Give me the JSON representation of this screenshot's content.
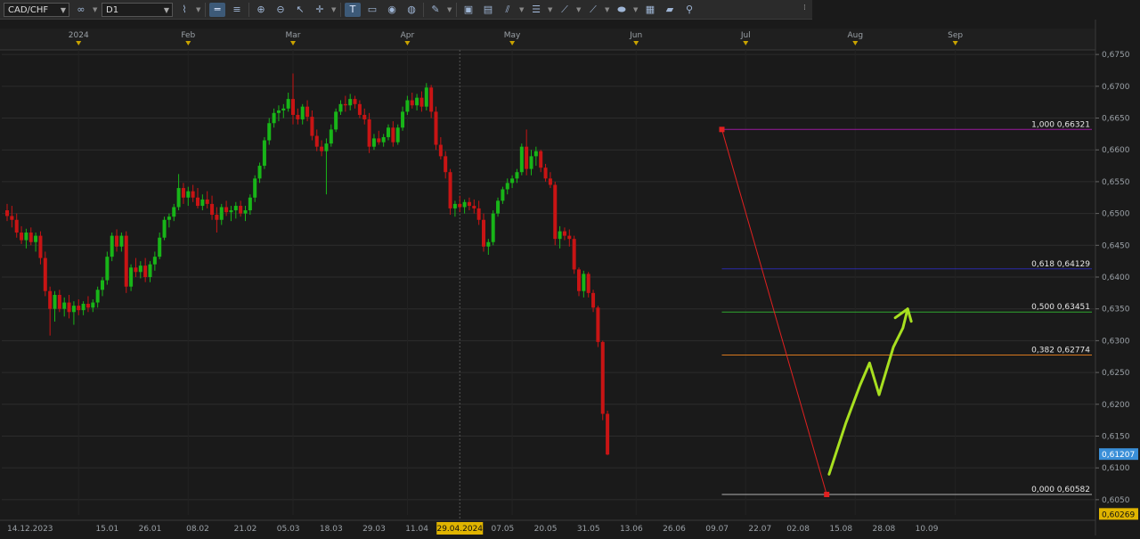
{
  "toolbar": {
    "symbol": "CAD/CHF",
    "timeframe": "D1",
    "icons": [
      "chart-type-icon",
      "line-style-icon",
      "zoom-in-icon",
      "zoom-out-icon",
      "cursor-icon",
      "crosshair-icon",
      "text-icon",
      "note-icon",
      "eye-icon",
      "globe-icon",
      "pencil-icon",
      "image-icon",
      "screenshot-icon",
      "fib-icon",
      "channel-icon",
      "trendline-icon",
      "arrow-icon",
      "shape-icon",
      "grid-icon",
      "eraser-icon",
      "indicator-icon"
    ]
  },
  "colors": {
    "bull": "#18b518",
    "bear": "#c81414",
    "grid": "#2c2c2c",
    "bg": "#1a1a1a",
    "axis_text": "#9aa0a6",
    "price_badge": "#3a8fd8",
    "low_badge": "#e0b400"
  },
  "chart_data": {
    "type": "candlestick",
    "symbol": "CAD/CHF",
    "timeframe": "D1",
    "ylim": [
      0.6026,
      0.676
    ],
    "y_ticks": [
      "0,6750",
      "0,6700",
      "0,6650",
      "0,6600",
      "0,6550",
      "0,6500",
      "0,6450",
      "0,6400",
      "0,6350",
      "0,6300",
      "0,6250",
      "0,6200",
      "0,6150",
      "0,6100",
      "0,6050"
    ],
    "y_tick_values": [
      0.675,
      0.67,
      0.665,
      0.66,
      0.655,
      0.65,
      0.645,
      0.64,
      0.635,
      0.63,
      0.625,
      0.62,
      0.615,
      0.61,
      0.605
    ],
    "month_labels": [
      {
        "label": "2024",
        "index": 15
      },
      {
        "label": "Feb",
        "index": 38
      },
      {
        "label": "Mar",
        "index": 60
      },
      {
        "label": "Apr",
        "index": 84
      },
      {
        "label": "May",
        "index": 106
      },
      {
        "label": "Jun",
        "index": 132
      },
      {
        "label": "Jul",
        "index": 155
      },
      {
        "label": "Aug",
        "index": 178
      },
      {
        "label": "Sep",
        "index": 199
      }
    ],
    "date_labels": [
      {
        "label": "14.12.2023",
        "index": 0
      },
      {
        "label": "15.01",
        "index": 21
      },
      {
        "label": "26.01",
        "index": 30
      },
      {
        "label": "08.02",
        "index": 40
      },
      {
        "label": "21.02",
        "index": 50
      },
      {
        "label": "05.03",
        "index": 59
      },
      {
        "label": "18.03",
        "index": 68
      },
      {
        "label": "29.03",
        "index": 77
      },
      {
        "label": "11.04",
        "index": 86
      },
      {
        "label": "07.05",
        "index": 104
      },
      {
        "label": "20.05",
        "index": 113
      },
      {
        "label": "31.05",
        "index": 122
      },
      {
        "label": "13.06",
        "index": 131
      },
      {
        "label": "26.06",
        "index": 140
      },
      {
        "label": "09.07",
        "index": 149
      },
      {
        "label": "22.07",
        "index": 158
      },
      {
        "label": "02.08",
        "index": 166
      },
      {
        "label": "15.08",
        "index": 175
      },
      {
        "label": "28.08",
        "index": 184
      },
      {
        "label": "10.09",
        "index": 193
      }
    ],
    "cursor_date": "29.04.2024",
    "cursor_index": 95,
    "current_price": "0,61207",
    "low_price": "0,60269",
    "candles": [
      [
        0.6505,
        0.6515,
        0.6488,
        0.6496
      ],
      [
        0.6496,
        0.6512,
        0.6478,
        0.649
      ],
      [
        0.649,
        0.65,
        0.6462,
        0.647
      ],
      [
        0.647,
        0.648,
        0.6452,
        0.6458
      ],
      [
        0.6458,
        0.6476,
        0.6445,
        0.647
      ],
      [
        0.647,
        0.6478,
        0.645,
        0.6455
      ],
      [
        0.6455,
        0.647,
        0.644,
        0.6465
      ],
      [
        0.6465,
        0.6472,
        0.642,
        0.643
      ],
      [
        0.643,
        0.644,
        0.637,
        0.6378
      ],
      [
        0.6378,
        0.6385,
        0.6308,
        0.635
      ],
      [
        0.635,
        0.6378,
        0.633,
        0.6372
      ],
      [
        0.6372,
        0.638,
        0.6345,
        0.635
      ],
      [
        0.635,
        0.6368,
        0.6338,
        0.636
      ],
      [
        0.636,
        0.6372,
        0.6335,
        0.6345
      ],
      [
        0.6345,
        0.6362,
        0.6325,
        0.6355
      ],
      [
        0.6355,
        0.6365,
        0.634,
        0.6348
      ],
      [
        0.6348,
        0.6362,
        0.634,
        0.6358
      ],
      [
        0.6358,
        0.637,
        0.6345,
        0.6352
      ],
      [
        0.6352,
        0.6365,
        0.6345,
        0.636
      ],
      [
        0.636,
        0.6385,
        0.6352,
        0.638
      ],
      [
        0.638,
        0.64,
        0.637,
        0.6395
      ],
      [
        0.6395,
        0.644,
        0.6388,
        0.6432
      ],
      [
        0.6432,
        0.647,
        0.6425,
        0.6465
      ],
      [
        0.6465,
        0.6475,
        0.644,
        0.6448
      ],
      [
        0.6448,
        0.647,
        0.644,
        0.6465
      ],
      [
        0.6465,
        0.6472,
        0.6375,
        0.6385
      ],
      [
        0.6385,
        0.642,
        0.6378,
        0.6415
      ],
      [
        0.6415,
        0.643,
        0.64,
        0.6408
      ],
      [
        0.6408,
        0.6425,
        0.6398,
        0.6418
      ],
      [
        0.6418,
        0.643,
        0.6392,
        0.64
      ],
      [
        0.64,
        0.6425,
        0.6392,
        0.642
      ],
      [
        0.642,
        0.644,
        0.641,
        0.6432
      ],
      [
        0.6432,
        0.647,
        0.6428,
        0.6462
      ],
      [
        0.6462,
        0.6495,
        0.6458,
        0.649
      ],
      [
        0.649,
        0.65,
        0.6478,
        0.6495
      ],
      [
        0.6495,
        0.6515,
        0.6488,
        0.651
      ],
      [
        0.651,
        0.6562,
        0.6505,
        0.654
      ],
      [
        0.654,
        0.6548,
        0.6515,
        0.6525
      ],
      [
        0.6525,
        0.6542,
        0.6512,
        0.6535
      ],
      [
        0.6535,
        0.6545,
        0.6518,
        0.6525
      ],
      [
        0.6525,
        0.654,
        0.6508,
        0.6512
      ],
      [
        0.6512,
        0.653,
        0.6505,
        0.6522
      ],
      [
        0.6522,
        0.6535,
        0.6508,
        0.6515
      ],
      [
        0.6515,
        0.6528,
        0.649,
        0.6498
      ],
      [
        0.6498,
        0.651,
        0.647,
        0.649
      ],
      [
        0.649,
        0.6515,
        0.6482,
        0.651
      ],
      [
        0.651,
        0.652,
        0.6496,
        0.6502
      ],
      [
        0.6502,
        0.6512,
        0.6488,
        0.6505
      ],
      [
        0.6505,
        0.6518,
        0.6492,
        0.6512
      ],
      [
        0.6512,
        0.652,
        0.6495,
        0.65
      ],
      [
        0.65,
        0.6512,
        0.6488,
        0.6505
      ],
      [
        0.6505,
        0.653,
        0.6498,
        0.6525
      ],
      [
        0.6525,
        0.656,
        0.6518,
        0.6555
      ],
      [
        0.6555,
        0.658,
        0.6548,
        0.6575
      ],
      [
        0.6575,
        0.662,
        0.657,
        0.6615
      ],
      [
        0.6615,
        0.665,
        0.6608,
        0.6642
      ],
      [
        0.6642,
        0.6665,
        0.6635,
        0.6658
      ],
      [
        0.6658,
        0.667,
        0.6645,
        0.6662
      ],
      [
        0.6662,
        0.6672,
        0.665,
        0.6665
      ],
      [
        0.6665,
        0.669,
        0.666,
        0.668
      ],
      [
        0.668,
        0.672,
        0.664,
        0.6655
      ],
      [
        0.6655,
        0.6665,
        0.664,
        0.6648
      ],
      [
        0.6648,
        0.6672,
        0.664,
        0.6668
      ],
      [
        0.6668,
        0.6678,
        0.6645,
        0.6652
      ],
      [
        0.6652,
        0.6662,
        0.6615,
        0.6622
      ],
      [
        0.6622,
        0.6632,
        0.6598,
        0.6605
      ],
      [
        0.6605,
        0.6615,
        0.659,
        0.6598
      ],
      [
        0.6598,
        0.6618,
        0.653,
        0.661
      ],
      [
        0.661,
        0.664,
        0.6605,
        0.6632
      ],
      [
        0.6632,
        0.6665,
        0.6628,
        0.666
      ],
      [
        0.666,
        0.6678,
        0.6655,
        0.6672
      ],
      [
        0.6672,
        0.6685,
        0.666,
        0.667
      ],
      [
        0.667,
        0.6688,
        0.6662,
        0.668
      ],
      [
        0.668,
        0.6685,
        0.6665,
        0.6672
      ],
      [
        0.6672,
        0.6678,
        0.665,
        0.6655
      ],
      [
        0.6655,
        0.6665,
        0.664,
        0.6648
      ],
      [
        0.6648,
        0.6658,
        0.6595,
        0.6605
      ],
      [
        0.6605,
        0.6625,
        0.66,
        0.6618
      ],
      [
        0.6618,
        0.663,
        0.6608,
        0.6612
      ],
      [
        0.6612,
        0.6625,
        0.6605,
        0.662
      ],
      [
        0.662,
        0.664,
        0.6615,
        0.6635
      ],
      [
        0.6635,
        0.6645,
        0.6605,
        0.6612
      ],
      [
        0.6612,
        0.664,
        0.6608,
        0.6635
      ],
      [
        0.6635,
        0.6668,
        0.663,
        0.666
      ],
      [
        0.666,
        0.6685,
        0.6655,
        0.6678
      ],
      [
        0.6678,
        0.669,
        0.6665,
        0.667
      ],
      [
        0.667,
        0.6688,
        0.6662,
        0.6682
      ],
      [
        0.6682,
        0.6692,
        0.666,
        0.6668
      ],
      [
        0.6668,
        0.6705,
        0.6662,
        0.6698
      ],
      [
        0.6698,
        0.6702,
        0.665,
        0.666
      ],
      [
        0.666,
        0.6668,
        0.66,
        0.6608
      ],
      [
        0.6608,
        0.662,
        0.6585,
        0.659
      ],
      [
        0.659,
        0.6598,
        0.6555,
        0.6565
      ],
      [
        0.6565,
        0.657,
        0.6498,
        0.6508
      ],
      [
        0.6508,
        0.652,
        0.6495,
        0.6515
      ],
      [
        0.6515,
        0.6528,
        0.6502,
        0.651
      ],
      [
        0.651,
        0.6522,
        0.65,
        0.6518
      ],
      [
        0.6518,
        0.6525,
        0.6505,
        0.6512
      ],
      [
        0.6512,
        0.6522,
        0.65,
        0.6508
      ],
      [
        0.6508,
        0.652,
        0.6482,
        0.649
      ],
      [
        0.649,
        0.65,
        0.644,
        0.6448
      ],
      [
        0.6448,
        0.646,
        0.6435,
        0.6455
      ],
      [
        0.6455,
        0.6505,
        0.645,
        0.65
      ],
      [
        0.65,
        0.6525,
        0.6495,
        0.652
      ],
      [
        0.652,
        0.6542,
        0.6515,
        0.6538
      ],
      [
        0.6538,
        0.6555,
        0.653,
        0.6548
      ],
      [
        0.6548,
        0.656,
        0.654,
        0.6555
      ],
      [
        0.6555,
        0.657,
        0.6548,
        0.6565
      ],
      [
        0.6565,
        0.661,
        0.656,
        0.6605
      ],
      [
        0.6605,
        0.6632,
        0.656,
        0.657
      ],
      [
        0.657,
        0.66,
        0.656,
        0.659
      ],
      [
        0.659,
        0.6605,
        0.6575,
        0.6598
      ],
      [
        0.6598,
        0.66,
        0.6565,
        0.6572
      ],
      [
        0.6572,
        0.6578,
        0.655,
        0.6555
      ],
      [
        0.6555,
        0.6565,
        0.654,
        0.6545
      ],
      [
        0.6545,
        0.655,
        0.645,
        0.646
      ],
      [
        0.646,
        0.648,
        0.6445,
        0.6472
      ],
      [
        0.6472,
        0.6478,
        0.6458,
        0.6465
      ],
      [
        0.6465,
        0.6475,
        0.6448,
        0.646
      ],
      [
        0.646,
        0.6465,
        0.6405,
        0.6412
      ],
      [
        0.6412,
        0.6415,
        0.637,
        0.6378
      ],
      [
        0.6378,
        0.641,
        0.6368,
        0.6405
      ],
      [
        0.6405,
        0.6408,
        0.6368,
        0.6375
      ],
      [
        0.6375,
        0.638,
        0.6345,
        0.6352
      ],
      [
        0.6352,
        0.6355,
        0.629,
        0.6298
      ],
      [
        0.6298,
        0.63,
        0.6175,
        0.6185
      ],
      [
        0.6185,
        0.619,
        0.612,
        0.6121
      ]
    ],
    "fibonacci": {
      "start_index": 150,
      "end_index": 172,
      "levels": [
        {
          "ratio": "1,000",
          "price": 0.66321,
          "label": "1,000 0,66321",
          "color": "#9b1aa0"
        },
        {
          "ratio": "0,618",
          "price": 0.64129,
          "label": "0,618 0,64129",
          "color": "#2a2aa8"
        },
        {
          "ratio": "0,500",
          "price": 0.63451,
          "label": "0,500 0,63451",
          "color": "#2ea82e"
        },
        {
          "ratio": "0,382",
          "price": 0.62774,
          "label": "0,382 0,62774",
          "color": "#d8781e"
        },
        {
          "ratio": "0,000",
          "price": 0.60582,
          "label": "0,000 0,60582",
          "color": "#b0b0b0"
        }
      ]
    },
    "annotation_path": [
      [
        172.5,
        0.609
      ],
      [
        176,
        0.617
      ],
      [
        179,
        0.623
      ],
      [
        181,
        0.6265
      ],
      [
        183,
        0.6215
      ],
      [
        186,
        0.629
      ],
      [
        188,
        0.632
      ],
      [
        189,
        0.635
      ]
    ]
  }
}
